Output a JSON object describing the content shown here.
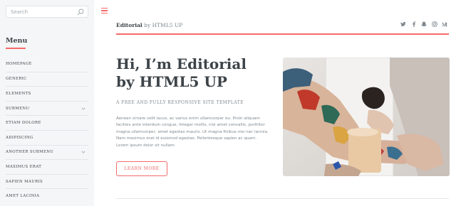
{
  "sidebar": {
    "search_placeholder": "Search",
    "heading": "Menu",
    "items": [
      {
        "label": "HOMEPAGE"
      },
      {
        "label": "GENERIC"
      },
      {
        "label": "ELEMENTS"
      },
      {
        "label": "SUBMENU"
      },
      {
        "label": "ETIAM DOLORE"
      },
      {
        "label": "ADIPISCING"
      },
      {
        "label": "ANOTHER SUBMENU"
      },
      {
        "label": "MAXIMUS ERAT"
      },
      {
        "label": "SAPIEN MAURIS"
      },
      {
        "label": "AMET LACINIA"
      }
    ]
  },
  "header": {
    "brand_bold": "Editorial",
    "brand_rest": " by HTML5 UP",
    "social_icons": [
      "twitter-icon",
      "facebook-icon",
      "snapchat-icon",
      "instagram-icon",
      "medium-icon"
    ]
  },
  "banner": {
    "title": "Hi, I’m Editorial\nby HTML5 UP",
    "subtitle": "A FREE AND FULLY RESPONSIVE SITE TEMPLATE",
    "body": "Aenean ornare velit lacus, ac varius enim ullamcorper eu. Proin aliquam facilisis ante interdum congue. Integer mollis, nisl amet convallis, porttitor magna ullamcorper, amet egestas mauris. Ut magna finibus nisi nec lacinia. Nam maximus erat id euismod egestas. Pellentesque sapien ac quam. Lorem ipsum dolor sit nullam.",
    "button": "LEARN MORE"
  },
  "colors": {
    "accent": "#f56a6a",
    "heading": "#3d4449",
    "text": "#7f888f",
    "sidebar_bg": "#f5f6f7"
  }
}
